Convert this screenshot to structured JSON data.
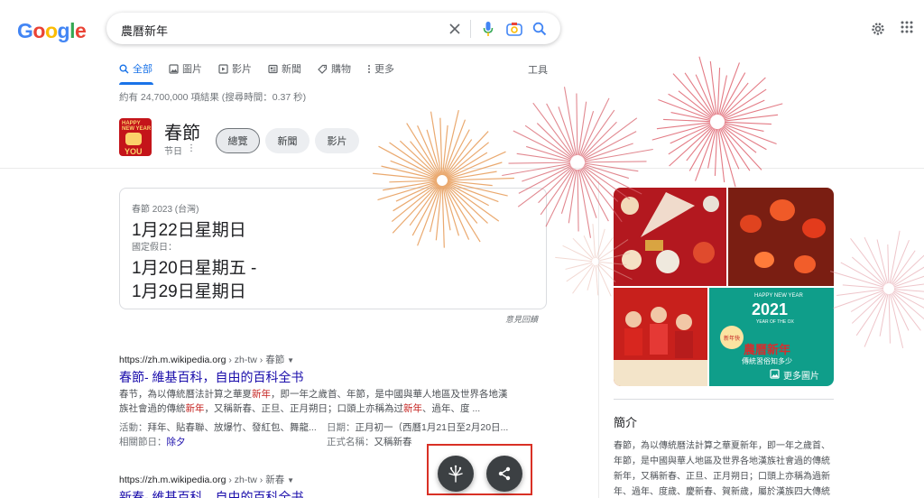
{
  "logo": "Google",
  "search": {
    "query": "農曆新年"
  },
  "tabs": [
    {
      "label": "全部",
      "icon": "search-icon"
    },
    {
      "label": "圖片",
      "icon": "image-icon"
    },
    {
      "label": "影片",
      "icon": "video-icon"
    },
    {
      "label": "新聞",
      "icon": "news-icon"
    },
    {
      "label": "購物",
      "icon": "tag-icon"
    },
    {
      "label": "更多",
      "icon": "more-vert-icon"
    }
  ],
  "tools_label": "工具",
  "result_stats": "約有 24,700,000 項結果 (搜尋時間：0.37 秒)",
  "entity": {
    "title": "春節",
    "subtitle": "节日",
    "thumb_text_top": "HAPPY NEW YEAR",
    "thumb_text_bottom": "YOU",
    "chips": [
      "總覽",
      "新聞",
      "影片"
    ]
  },
  "date_card": {
    "label1": "春節 2023 (台灣)",
    "date1": "1月22日星期日",
    "label2": "國定假日：",
    "date2": "1月20日星期五 -",
    "date3": "1月29日星期日",
    "feedback": "意見回饋"
  },
  "results": [
    {
      "url": "https://zh.m.wikipedia.org",
      "crumb": " › zh-tw › 春節",
      "title": "春節- 維基百科，自由的百科全书",
      "snippet_parts": [
        {
          "t": "春节，為以傳統曆法計算之華夏",
          "em": false
        },
        {
          "t": "新年",
          "em": true
        },
        {
          "t": "，即一年之歲首、年節，是中國與華人地區及世界各地漢族社會過的傳統",
          "em": false
        },
        {
          "t": "新年",
          "em": true
        },
        {
          "t": "，又稱新春、正旦、正月朔日；口頭上亦稱為过",
          "em": false
        },
        {
          "t": "新年",
          "em": true
        },
        {
          "t": "、過年、度 ...",
          "em": false
        }
      ],
      "meta_left_label": "活動：",
      "meta_left_value": "拜年、貼春聯、放爆竹、發紅包、舞龍...",
      "meta_right_label": "日期：",
      "meta_right_value": "正月初一（西曆1月21日至2月20日...",
      "meta2_left_label": "相關節日：",
      "meta2_left_value": "除夕",
      "meta2_right_label": "正式名稱：",
      "meta2_right_value": "又稱新春"
    },
    {
      "url": "https://zh.m.wikipedia.org",
      "crumb": " › zh-tw › 新春",
      "title": "新春- 維基百科，自由的百科全书"
    }
  ],
  "knowledge_panel": {
    "more_images": "更多圖片",
    "card_year": "2021",
    "card_heading": "HAPPY NEW YEAR",
    "card_sub": "YEAR OF THE OX",
    "card_title": "農曆新年",
    "card_subtitle": "傳統習俗知多少",
    "card_badge": "新年快",
    "section_title": "簡介",
    "description": "春節，為以傳統曆法計算之華夏新年，即一年之歲首、年節，是中國與華人地區及世界各地漢族社會過的傳統新年，又稱新春、正旦、正月朔日；口頭上亦稱為過新年、過年、度歲、慶新春、賀新歲，屬於漢族四大傳統"
  },
  "colors": {
    "link": "#1a0dab",
    "accent": "#1a73e8",
    "highlight": "#d93025",
    "fab": "#3c4043"
  }
}
